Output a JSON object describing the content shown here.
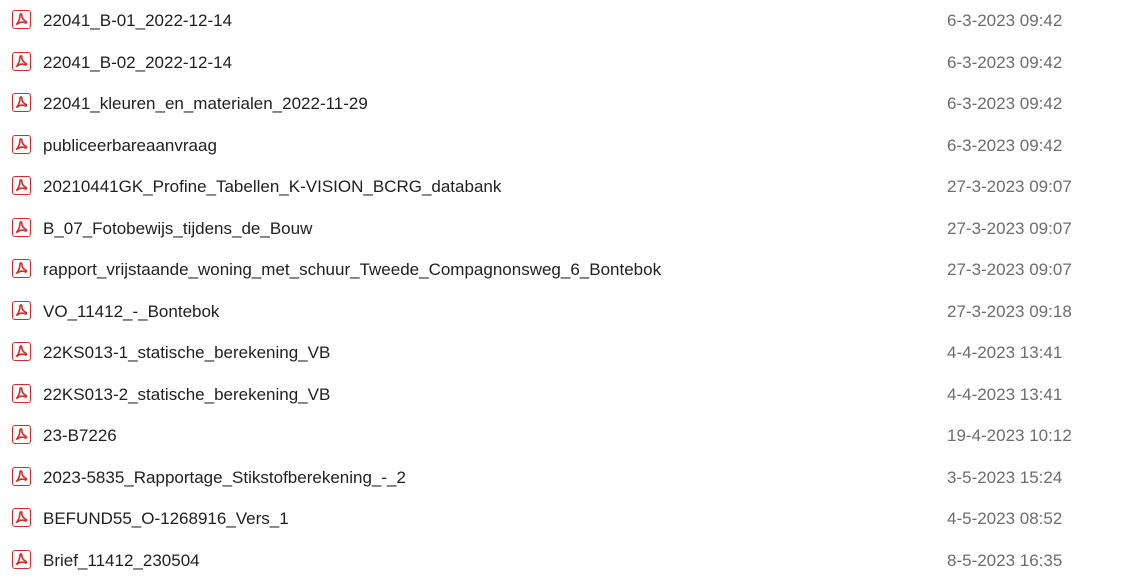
{
  "files": [
    {
      "icon": "pdf-file-icon",
      "name": "22041_B-01_2022-12-14",
      "date_modified": "6-3-2023 09:42"
    },
    {
      "icon": "pdf-file-icon",
      "name": "22041_B-02_2022-12-14",
      "date_modified": "6-3-2023 09:42"
    },
    {
      "icon": "pdf-file-icon",
      "name": "22041_kleuren_en_materialen_2022-11-29",
      "date_modified": "6-3-2023 09:42"
    },
    {
      "icon": "pdf-file-icon",
      "name": "publiceerbareaanvraag",
      "date_modified": "6-3-2023 09:42"
    },
    {
      "icon": "pdf-file-icon",
      "name": "20210441GK_Profine_Tabellen_K-VISION_BCRG_databank",
      "date_modified": "27-3-2023 09:07"
    },
    {
      "icon": "pdf-file-icon",
      "name": "B_07_Fotobewijs_tijdens_de_Bouw",
      "date_modified": "27-3-2023 09:07"
    },
    {
      "icon": "pdf-file-icon",
      "name": "rapport_vrijstaande_woning_met_schuur_Tweede_Compagnonsweg_6_Bontebok",
      "date_modified": "27-3-2023 09:07"
    },
    {
      "icon": "pdf-file-icon",
      "name": "VO_11412_-_Bontebok",
      "date_modified": "27-3-2023 09:18"
    },
    {
      "icon": "pdf-file-icon",
      "name": "22KS013-1_statische_berekening_VB",
      "date_modified": "4-4-2023 13:41"
    },
    {
      "icon": "pdf-file-icon",
      "name": "22KS013-2_statische_berekening_VB",
      "date_modified": "4-4-2023 13:41"
    },
    {
      "icon": "pdf-file-icon",
      "name": "23-B7226",
      "date_modified": "19-4-2023 10:12"
    },
    {
      "icon": "pdf-file-icon",
      "name": "2023-5835_Rapportage_Stikstofberekening_-_2",
      "date_modified": "3-5-2023 15:24"
    },
    {
      "icon": "pdf-file-icon",
      "name": "BEFUND55_O-1268916_Vers_1",
      "date_modified": "4-5-2023 08:52"
    },
    {
      "icon": "pdf-file-icon",
      "name": "Brief_11412_230504",
      "date_modified": "8-5-2023 16:35"
    }
  ],
  "colors": {
    "pdf_icon": "#d42a2a",
    "name_text": "#1f1f1f",
    "date_text": "#6d6d6d",
    "hover_background": "#e5f3ff"
  }
}
